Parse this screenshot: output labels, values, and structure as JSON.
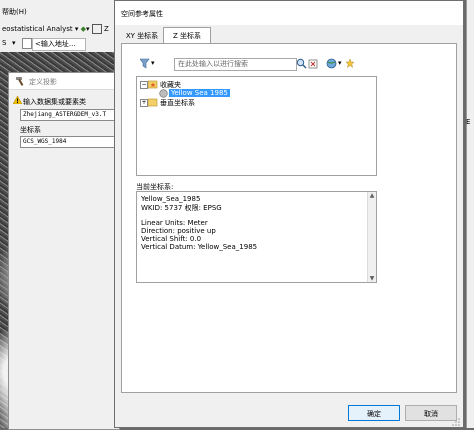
{
  "background": {
    "menu": "帮助(H)",
    "toolbar_label": "eostatistical Analyst",
    "toolbar_extra": "Z",
    "address_prefix": "S",
    "address_placeholder": "<输入地址...",
    "right_edge_char": "E"
  },
  "define_projection": {
    "title": "定义投影",
    "input_label": "输入数据集或要素类",
    "input_value": "Zhejiang_ASTERGDEM_v3.T",
    "cs_label": "坐标系",
    "cs_value": "GCS_WGS_1984"
  },
  "dialog": {
    "title": "空间参考属性",
    "tabs": [
      "XY 坐标系",
      "Z 坐标系"
    ],
    "active_tab": 1,
    "search_placeholder": "在此处输入以进行搜索",
    "tree": {
      "favorites": "收藏夹",
      "selected_item": "Yellow Sea 1985",
      "vertical": "垂直坐标系"
    },
    "current_label": "当前坐标系:",
    "current_details": [
      "Yellow_Sea_1985",
      "WKID: 5737 权限: EPSG",
      "",
      "Linear Units: Meter",
      "Direction: positive up",
      "Vertical Shift: 0.0",
      "Vertical Datum: Yellow_Sea_1985"
    ],
    "ok_label": "确定",
    "cancel_label": "取消"
  },
  "colors": {
    "selection": "#3399ff",
    "ok_border": "#0078d7",
    "window_bg": "#f0f0f0"
  }
}
